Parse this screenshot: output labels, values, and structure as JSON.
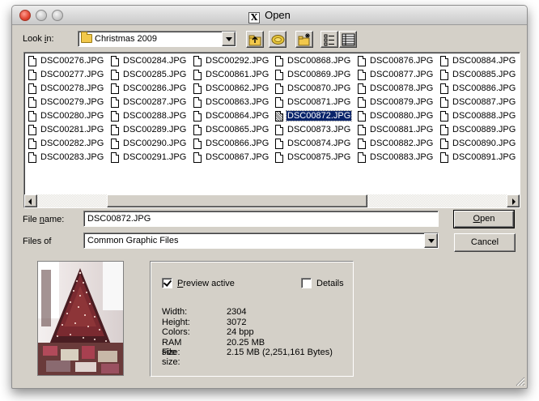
{
  "window": {
    "title": "Open",
    "x_logo": "X"
  },
  "lookin": {
    "label_prefix": "Look ",
    "label_underlined": "i",
    "label_suffix": "n:",
    "value": "Christmas 2009"
  },
  "toolbar": {
    "icons": [
      "up-folder-icon",
      "desktop-icon",
      "new-folder-icon",
      "list-view-icon",
      "details-view-icon"
    ]
  },
  "files": {
    "columns": [
      [
        "DSC00276.JPG",
        "DSC00277.JPG",
        "DSC00278.JPG",
        "DSC00279.JPG",
        "DSC00280.JPG",
        "DSC00281.JPG",
        "DSC00282.JPG",
        "DSC00283.JPG"
      ],
      [
        "DSC00284.JPG",
        "DSC00285.JPG",
        "DSC00286.JPG",
        "DSC00287.JPG",
        "DSC00288.JPG",
        "DSC00289.JPG",
        "DSC00290.JPG",
        "DSC00291.JPG"
      ],
      [
        "DSC00292.JPG",
        "DSC00861.JPG",
        "DSC00862.JPG",
        "DSC00863.JPG",
        "DSC00864.JPG",
        "DSC00865.JPG",
        "DSC00866.JPG",
        "DSC00867.JPG"
      ],
      [
        "DSC00868.JPG",
        "DSC00869.JPG",
        "DSC00870.JPG",
        "DSC00871.JPG",
        "DSC00872.JPG",
        "DSC00873.JPG",
        "DSC00874.JPG",
        "DSC00875.JPG"
      ],
      [
        "DSC00876.JPG",
        "DSC00877.JPG",
        "DSC00878.JPG",
        "DSC00879.JPG",
        "DSC00880.JPG",
        "DSC00881.JPG",
        "DSC00882.JPG",
        "DSC00883.JPG"
      ],
      [
        "DSC00884.JPG",
        "DSC00885.JPG",
        "DSC00886.JPG",
        "DSC00887.JPG",
        "DSC00888.JPG",
        "DSC00889.JPG",
        "DSC00890.JPG",
        "DSC00891.JPG"
      ]
    ],
    "selected": "DSC00872.JPG"
  },
  "filename": {
    "label_prefix": "File ",
    "label_underlined": "n",
    "label_suffix": "ame:",
    "value": "DSC00872.JPG"
  },
  "filetype": {
    "label": "Files of",
    "value": "Common Graphic Files"
  },
  "buttons": {
    "open_underlined": "O",
    "open_rest": "pen",
    "cancel": "Cancel"
  },
  "preview": {
    "active_underlined": "P",
    "active_rest": "review active",
    "active_checked": true,
    "details_label": "Details",
    "details_checked": false,
    "info": [
      {
        "key": "Width:",
        "value": "2304"
      },
      {
        "key": "Height:",
        "value": "3072"
      },
      {
        "key": "Colors:",
        "value": "24 bpp"
      },
      {
        "key": "RAM size:",
        "value": "20.25 MB"
      },
      {
        "key": "File size:",
        "value": "2.15 MB (2,251,161 Bytes)"
      }
    ]
  },
  "colors": {
    "dialog_bg": "#d4d0c8",
    "selection_bg": "#0a246a",
    "close_button": "#e0432f"
  }
}
